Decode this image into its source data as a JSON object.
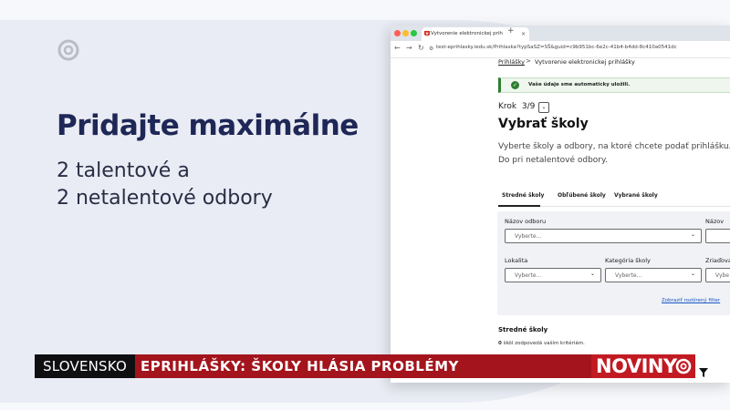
{
  "slide": {
    "headline": "Pridajte maximálne",
    "subline_1": "2 talentové a",
    "subline_2": "2 netalentové odbory"
  },
  "browser": {
    "tab_title": "Vytvorenie elektronickej prih",
    "tab_close": "×",
    "new_tab": "+",
    "url": "test-eprihlasky.iedu.sk/Prihlaska?typSaSZ=SŠ&guid=c9b951bc-6e2c-41b4-b4dd-8c410a0541dc"
  },
  "page": {
    "breadcrumb": {
      "home": "Prihlášky",
      "separator": ">",
      "current": "Vytvorenie elektronickej prihlášky"
    },
    "alert": {
      "text": "Vaše údaje sme automaticky uložili.",
      "icon": "check-circle-icon"
    },
    "step": {
      "label": "Krok",
      "value": "3/9",
      "toggle": "⌄"
    },
    "title": "Vybrať školy",
    "description": "Vyberte školy a odbory, na ktoré chcete podať prihlášku. Do pri netalentové odbory.",
    "tabs": [
      {
        "label": "Stredné školy",
        "active": true
      },
      {
        "label": "Obľúbené školy",
        "active": false
      },
      {
        "label": "Vybrané školy",
        "active": false
      }
    ],
    "filters": {
      "field_name_label": "Názov odboru",
      "field_name_placeholder": "Vyberte...",
      "school_name_label": "Názov",
      "locality_label": "Lokalita",
      "locality_placeholder": "Vyberte...",
      "category_label": "Kategória školy",
      "category_placeholder": "Vyberte...",
      "founder_label": "Zriaďova",
      "founder_placeholder": "Vybe",
      "extended_link": "Zobraziť rozšírený filter"
    },
    "results": {
      "title": "Stredné školy",
      "count": "0",
      "count_text": " škôl zodpovedá vaším kritériám."
    }
  },
  "banner": {
    "region": "SLOVENSKO",
    "headline": "EPRIHLÁŠKY: ŠKOLY HLÁSIA PROBLÉMY",
    "brand": "NOVINY"
  },
  "colors": {
    "headline_navy": "#1e2756",
    "banner_red": "#a3141c",
    "brand_red": "#c11a22",
    "alert_green": "#2e7d32",
    "link_blue": "#1a56c4"
  }
}
